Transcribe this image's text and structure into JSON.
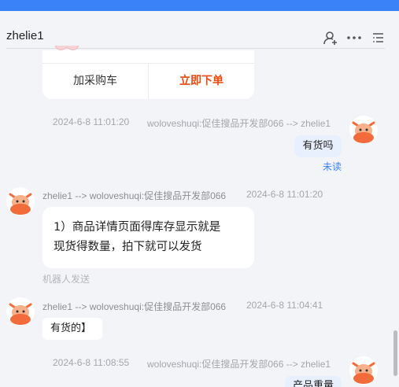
{
  "topbar": {
    "title": ""
  },
  "header": {
    "contact_name": "zhelie1"
  },
  "product_card": {
    "add_cart_label": "加采购车",
    "buy_now_label": "立即下单"
  },
  "messages": [
    {
      "time": "2024-6-8 11:01:20",
      "route": "woloveshuqi:促佳搜品开发部066 --> zhelie1",
      "text": "有货吗",
      "status": "未读"
    },
    {
      "time": "2024-6-8 11:01:20",
      "route": "zhelie1 --> woloveshuqi:促佳搜品开发部066",
      "line1": "1）商品详情页面得库存显示就是",
      "line2": "现货得数量，拍下就可以发货",
      "note": "机器人发送"
    },
    {
      "time": "2024-6-8 11:04:41",
      "route": "zhelie1 --> woloveshuqi:促佳搜品开发部066",
      "text": "有货的】"
    },
    {
      "time": "2024-6-8 11:08:55",
      "route": "woloveshuqi:促佳搜品开发部066 --> zhelie1",
      "text": "产品重量"
    }
  ],
  "icons": [
    "add-contact-icon",
    "more-icon",
    "list-icon",
    "avatar-icon"
  ],
  "colors": {
    "accent": "#3a82f7",
    "buy": "#e64a0f",
    "avatar": "#f26b3a"
  }
}
